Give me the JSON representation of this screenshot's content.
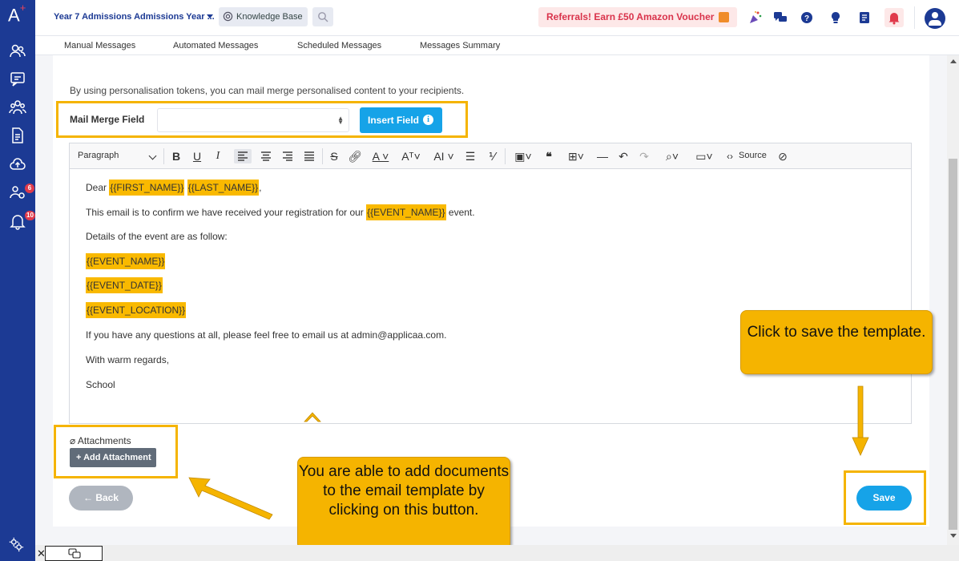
{
  "app": {
    "logo": "A",
    "title": "Year 7 Admissions Admissions Year ...",
    "knowledge_base": "Knowledge Base",
    "referral": "Referrals! Earn £50 Amazon Voucher"
  },
  "sidebar": {
    "badges": {
      "users": "6",
      "notifications": "10"
    }
  },
  "tabs": [
    "Manual Messages",
    "Automated Messages",
    "Scheduled Messages",
    "Messages Summary"
  ],
  "form": {
    "intro": "By using personalisation tokens, you can mail merge personalised content to your recipients.",
    "mail_merge_label": "Mail Merge Field",
    "mail_merge_value": "",
    "insert_field_label": "Insert Field"
  },
  "editor": {
    "paragraph_style": "Paragraph",
    "source_label": "Source",
    "lines": {
      "dear": "Dear",
      "first_name": "{{FIRST_NAME}}",
      "last_name": "{{LAST_NAME}}",
      "comma": ",",
      "confirm_prefix": "This email is to confirm we have received your registration for our",
      "event_name": "{{EVENT_NAME}}",
      "confirm_suffix": "event.",
      "details": "Details of the event are as follow:",
      "event_name_token": "{{EVENT_NAME}}",
      "event_date_token": "{{EVENT_DATE}}",
      "event_location_token": "{{EVENT_LOCATION}}",
      "questions": "If you have any questions at all, please feel free to email us at admin@applicaa.com.",
      "regards": "With warm regards,",
      "signature": "School"
    }
  },
  "attachments": {
    "label": "Attachments",
    "add_button": "+ Add Attachment"
  },
  "actions": {
    "back": "← Back",
    "save": "Save"
  },
  "callouts": {
    "save": "Click to save the template.",
    "attachment": "You are able to add documents to the email template by clicking on this button."
  }
}
